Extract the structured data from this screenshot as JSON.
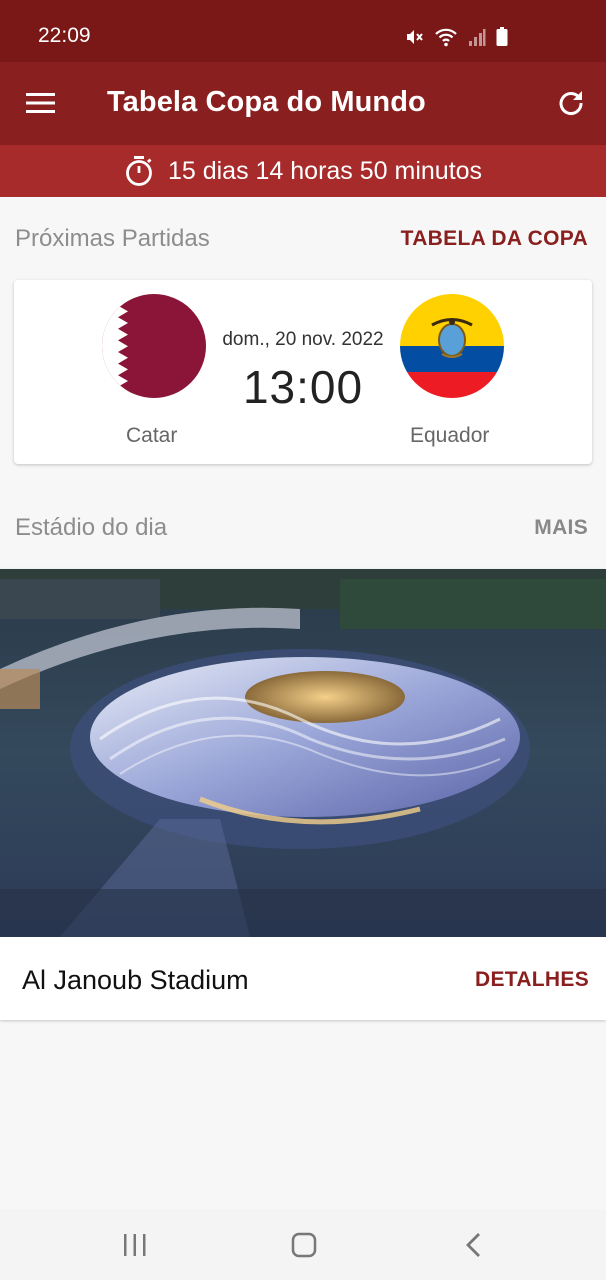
{
  "status_bar": {
    "time": "22:09",
    "icons": [
      "mute-icon",
      "wifi-icon",
      "signal-icon",
      "battery-icon"
    ]
  },
  "app_bar": {
    "title": "Tabela Copa do Mundo",
    "menu_icon": "hamburger-menu-icon",
    "refresh_icon": "refresh-icon"
  },
  "countdown": {
    "icon": "stopwatch-icon",
    "text": "15 dias 14 horas 50 minutos"
  },
  "next_matches": {
    "title": "Próximas Partidas",
    "link_label": "TABELA DA COPA",
    "match": {
      "home_team": "Catar",
      "away_team": "Equador",
      "date": "dom., 20 nov. 2022",
      "time": "13:00"
    }
  },
  "stadium_of_day": {
    "title": "Estádio do dia",
    "link_label": "MAIS",
    "stadium_name": "Al Janoub Stadium",
    "details_label": "DETALHES"
  },
  "nav_bar": {
    "icons": [
      "recent-apps-icon",
      "home-icon",
      "back-icon"
    ]
  },
  "colors": {
    "status_bar": "#7a1717",
    "app_bar": "#8a1f1f",
    "countdown_bar": "#a72b2b",
    "accent": "#8a1f1f",
    "qatar_maroon": "#8a1538",
    "ecuador_yellow": "#ffd100",
    "ecuador_blue": "#034ea2",
    "ecuador_red": "#ed1c24"
  }
}
